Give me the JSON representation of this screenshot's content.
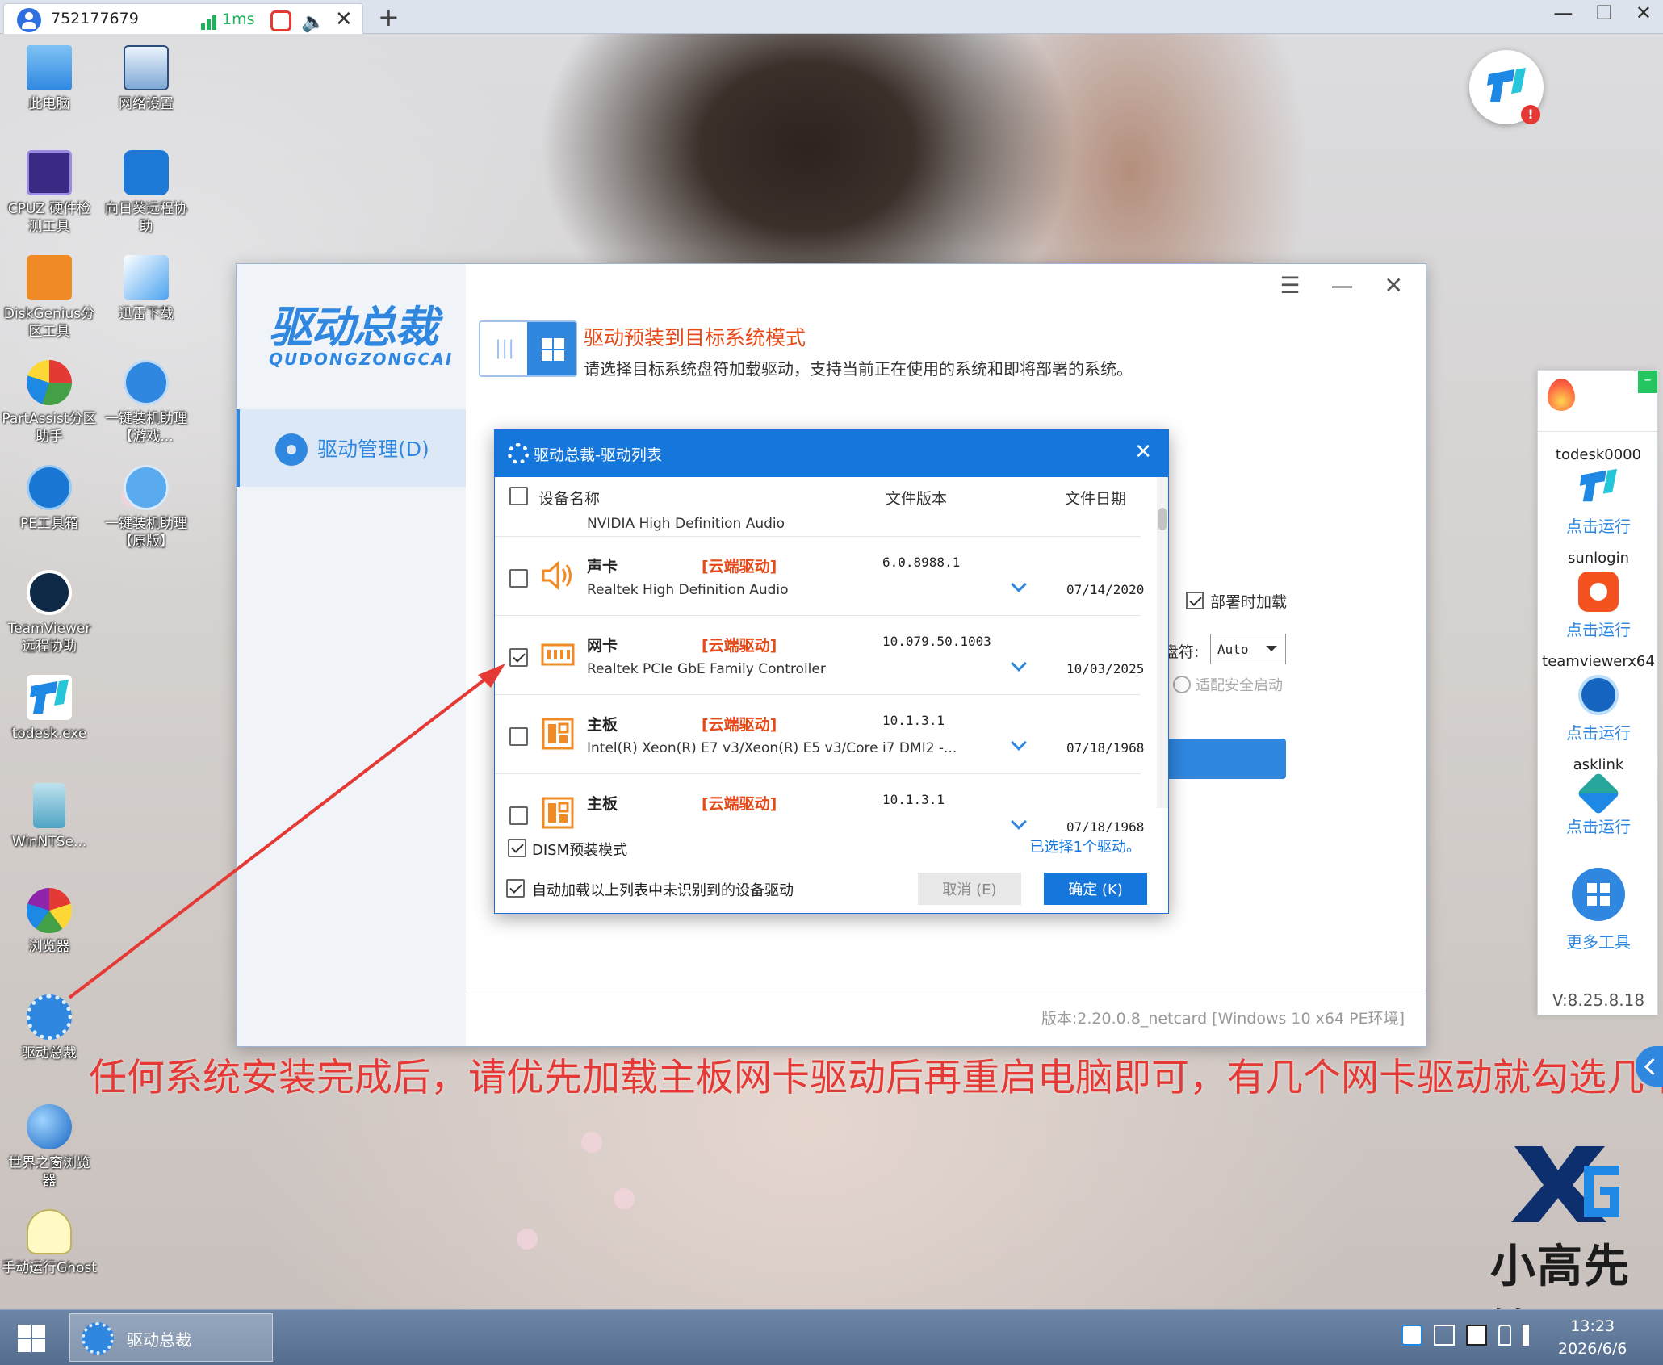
{
  "session": {
    "id": "752177679",
    "latency": "1ms"
  },
  "desktop_icons": [
    {
      "label": "此电脑",
      "icon": "computer-icon"
    },
    {
      "label": "网络设置",
      "icon": "network-icon"
    },
    {
      "label": "CPUZ 硬件检测工具",
      "icon": "cpu-icon"
    },
    {
      "label": "向日葵远程协助",
      "icon": "sunlogin-icon"
    },
    {
      "label": "DiskGenius分区工具",
      "icon": "diskgenius-icon"
    },
    {
      "label": "迅雷下载",
      "icon": "thunder-icon"
    },
    {
      "label": "PartAssist分区助手",
      "icon": "partassist-icon"
    },
    {
      "label": "一键装机助理【游戏...",
      "icon": "installer-game-icon"
    },
    {
      "label": "PE工具箱",
      "icon": "pe-toolbox-icon"
    },
    {
      "label": "一键装机助理【原版】",
      "icon": "installer-original-icon"
    },
    {
      "label": "TeamViewer远程协助",
      "icon": "teamviewer-icon"
    },
    {
      "label": "todesk.exe",
      "icon": "todesk-icon"
    },
    {
      "label": "WinNTSe...",
      "icon": "winntsetup-icon"
    },
    {
      "label": "浏览器",
      "icon": "browser-icon"
    },
    {
      "label": "驱动总裁",
      "icon": "driver-icon"
    },
    {
      "label": "世界之窗浏览器",
      "icon": "theworld-icon"
    },
    {
      "label": "手动运行Ghost",
      "icon": "ghost-icon"
    }
  ],
  "app": {
    "logo_main": "驱动总裁",
    "logo_sub": "QUDONGZONGCAI",
    "nav_label": "驱动管理(D)",
    "mode_title": "驱动预装到目标系统模式",
    "mode_desc": "请选择目标系统盘符加载驱动，支持当前正在使用的系统和即将部署的系统。",
    "deploy_load_label": "部署时加载",
    "letter_label": "盘符:",
    "letter_value": "Auto",
    "secure_boot_label": "适配安全启动",
    "version": "版本:2.20.0.8_netcard [Windows 10 x64 PE环境]"
  },
  "dialog": {
    "title": "驱动总裁-驱动列表",
    "columns": {
      "name": "设备名称",
      "version": "文件版本",
      "date": "文件日期"
    },
    "partial_row_sub": "NVIDIA High Definition Audio",
    "rows": [
      {
        "name": "声卡",
        "tag": "[云端驱动]",
        "version": "6.0.8988.1",
        "sub": "Realtek High Definition Audio",
        "date": "07/14/2020",
        "checked": false,
        "icon": "speaker-icon"
      },
      {
        "name": "网卡",
        "tag": "[云端驱动]",
        "version": "10.079.50.1003",
        "sub": "Realtek PCIe GbE Family Controller",
        "date": "10/03/2025",
        "checked": true,
        "icon": "network-card-icon"
      },
      {
        "name": "主板",
        "tag": "[云端驱动]",
        "version": "10.1.3.1",
        "sub": "Intel(R) Xeon(R) E7 v3/Xeon(R) E5 v3/Core i7 DMI2 -...",
        "date": "07/18/1968",
        "checked": false,
        "icon": "motherboard-icon"
      },
      {
        "name": "主板",
        "tag": "[云端驱动]",
        "version": "10.1.3.1",
        "sub": "",
        "date": "07/18/1968",
        "checked": false,
        "icon": "motherboard-icon"
      }
    ],
    "dism_label": "DISM预装模式",
    "selected_count": "已选择1个驱动。",
    "auto_load_label": "自动加载以上列表中未识别到的设备驱动",
    "cancel_label": "取消 (E)",
    "ok_label": "确定 (K)"
  },
  "caption": "任何系统安装完成后，请优先加载主板网卡驱动后再重启电脑即可，有几个网卡驱动就勾选几个",
  "tool_panel": {
    "items": [
      {
        "name": "todesk0000",
        "run": "点击运行"
      },
      {
        "name": "sunlogin",
        "run": "点击运行"
      },
      {
        "name": "teamviewerx64",
        "run": "点击运行"
      },
      {
        "name": "asklink",
        "run": "点击运行"
      }
    ],
    "more_label": "更多工具",
    "version": "V:8.25.8.18"
  },
  "brand": {
    "text": "小高先锋",
    "logo": "XG"
  },
  "taskbar": {
    "task_label": "驱动总裁",
    "time": "13:23",
    "date": "2026/6/6"
  },
  "colors": {
    "accent": "#2f87e0",
    "dialog_header": "#1577dc",
    "cloud_tag": "#e64a19",
    "caption": "#e53935"
  }
}
